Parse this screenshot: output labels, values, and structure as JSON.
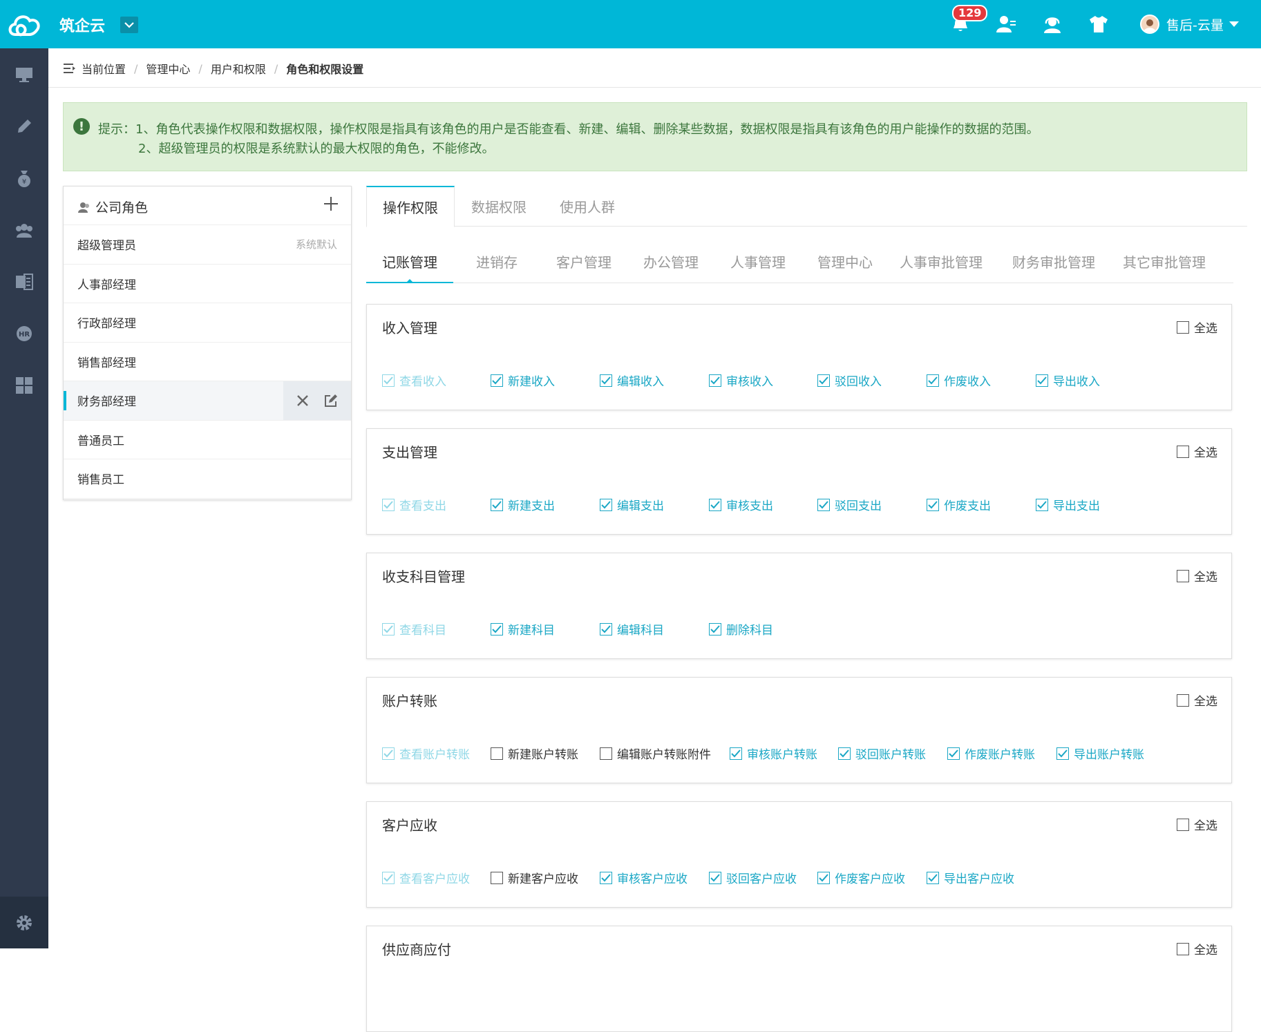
{
  "app": {
    "title": "筑企云",
    "notification_count": "129",
    "user_name": "售后-云量"
  },
  "breadcrumb": {
    "items": [
      "当前位置",
      "管理中心",
      "用户和权限",
      "角色和权限设置"
    ]
  },
  "tip": {
    "line1": "提示：1、角色代表操作权限和数据权限，操作权限是指具有该角色的用户是否能查看、新建、编辑、删除某些数据，数据权限是指具有该角色的用户能操作的数据的范围。",
    "line2": "2、超级管理员的权限是系统默认的最大权限的角色，不能修改。"
  },
  "roles": {
    "title": "公司角色",
    "items": [
      {
        "name": "超级管理员",
        "tag": "系统默认"
      },
      {
        "name": "人事部经理"
      },
      {
        "name": "行政部经理"
      },
      {
        "name": "销售部经理"
      },
      {
        "name": "财务部经理",
        "selected": true
      },
      {
        "name": "普通员工"
      },
      {
        "name": "销售员工"
      }
    ]
  },
  "tabs": [
    "操作权限",
    "数据权限",
    "使用人群"
  ],
  "subtabs": [
    "记账管理",
    "进销存",
    "客户管理",
    "办公管理",
    "人事管理",
    "管理中心",
    "人事审批管理",
    "财务审批管理",
    "其它审批管理"
  ],
  "select_all_label": "全选",
  "sections": [
    {
      "title": "收入管理",
      "perms": [
        {
          "label": "查看收入",
          "state": "disabled"
        },
        {
          "label": "新建收入",
          "state": "checked"
        },
        {
          "label": "编辑收入",
          "state": "checked"
        },
        {
          "label": "审核收入",
          "state": "checked"
        },
        {
          "label": "驳回收入",
          "state": "checked"
        },
        {
          "label": "作废收入",
          "state": "checked"
        },
        {
          "label": "导出收入",
          "state": "checked"
        }
      ]
    },
    {
      "title": "支出管理",
      "perms": [
        {
          "label": "查看支出",
          "state": "disabled"
        },
        {
          "label": "新建支出",
          "state": "checked"
        },
        {
          "label": "编辑支出",
          "state": "checked"
        },
        {
          "label": "审核支出",
          "state": "checked"
        },
        {
          "label": "驳回支出",
          "state": "checked"
        },
        {
          "label": "作废支出",
          "state": "checked"
        },
        {
          "label": "导出支出",
          "state": "checked"
        }
      ]
    },
    {
      "title": "收支科目管理",
      "perms": [
        {
          "label": "查看科目",
          "state": "disabled"
        },
        {
          "label": "新建科目",
          "state": "checked"
        },
        {
          "label": "编辑科目",
          "state": "checked"
        },
        {
          "label": "删除科目",
          "state": "checked"
        }
      ]
    },
    {
      "title": "账户转账",
      "perms": [
        {
          "label": "查看账户转账",
          "state": "disabled"
        },
        {
          "label": "新建账户转账",
          "state": "unchecked"
        },
        {
          "label": "编辑账户转账附件",
          "state": "unchecked"
        },
        {
          "label": "审核账户转账",
          "state": "checked"
        },
        {
          "label": "驳回账户转账",
          "state": "checked"
        },
        {
          "label": "作废账户转账",
          "state": "checked"
        },
        {
          "label": "导出账户转账",
          "state": "checked"
        }
      ]
    },
    {
      "title": "客户应收",
      "perms": [
        {
          "label": "查看客户应收",
          "state": "disabled"
        },
        {
          "label": "新建客户应收",
          "state": "unchecked"
        },
        {
          "label": "审核客户应收",
          "state": "checked"
        },
        {
          "label": "驳回客户应收",
          "state": "checked"
        },
        {
          "label": "作废客户应收",
          "state": "checked"
        },
        {
          "label": "导出客户应收",
          "state": "checked"
        }
      ]
    },
    {
      "title": "供应商应付",
      "perms": []
    }
  ],
  "colors": {
    "accent": "#00b7d7",
    "sidebar": "#2f3a4d",
    "tip_bg": "#dff0d8",
    "tip_text": "#3c763d",
    "checked": "#1aa7c5"
  }
}
